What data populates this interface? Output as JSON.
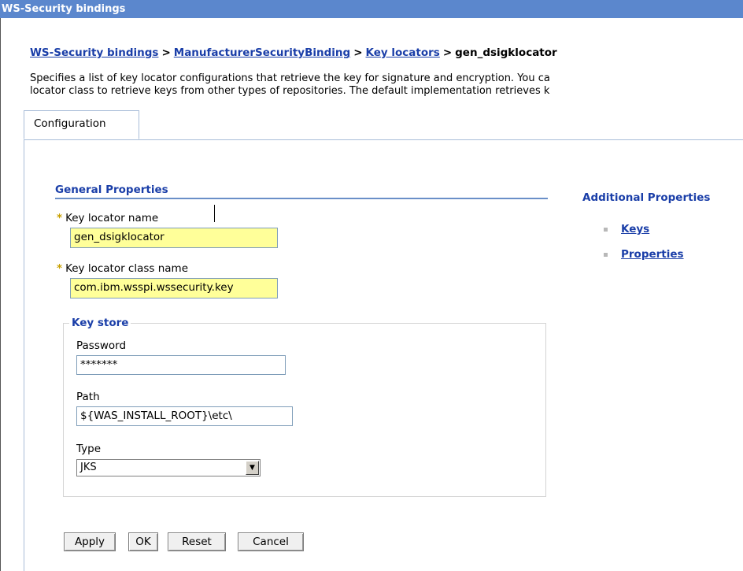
{
  "window": {
    "title": "WS-Security bindings"
  },
  "breadcrumb": {
    "items": [
      "WS-Security bindings",
      "ManufacturerSecurityBinding",
      "Key locators"
    ],
    "separator": ">",
    "current": "gen_dsigklocator"
  },
  "description": {
    "line1": "Specifies a list of key locator configurations that retrieve the key for signature and encryption. You ca",
    "line2": "locator class to retrieve keys from other types of repositories. The default implementation retrieves k"
  },
  "tabs": [
    {
      "label": "Configuration",
      "selected": true
    }
  ],
  "general_properties": {
    "title": "General Properties",
    "required_marker": "*",
    "key_locator_name": {
      "label": "Key locator name",
      "value": "gen_dsigklocator"
    },
    "key_locator_class_name": {
      "label": "Key locator class name",
      "value": "com.ibm.wsspi.wssecurity.key"
    },
    "key_store": {
      "legend": "Key store",
      "password": {
        "label": "Password",
        "value": "*******"
      },
      "path": {
        "label": "Path",
        "value": "${WAS_INSTALL_ROOT}\\etc\\"
      },
      "type": {
        "label": "Type",
        "selected": "JKS"
      }
    }
  },
  "additional_properties": {
    "title": "Additional Properties",
    "links": [
      "Keys",
      "Properties"
    ]
  },
  "buttons": {
    "apply": "Apply",
    "ok": "OK",
    "reset": "Reset",
    "cancel": "Cancel"
  },
  "colors": {
    "title_bar": "#5b87cd",
    "link": "#1a3ea8",
    "required_field": "#ffff99"
  },
  "icons": {
    "dropdown": "chevron-down-icon",
    "bullet": "square-bullet-icon"
  }
}
